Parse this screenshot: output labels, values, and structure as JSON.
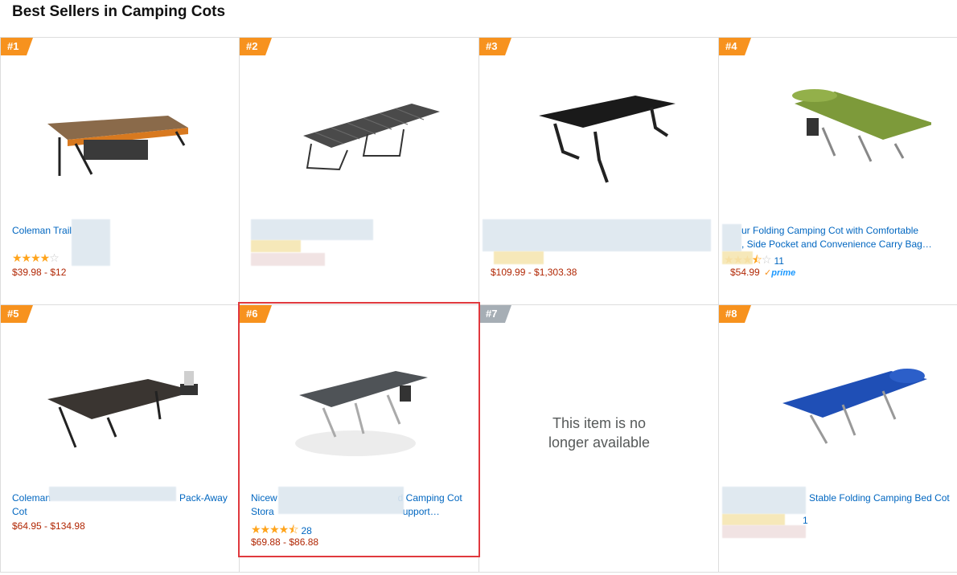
{
  "page": {
    "title": "Best Sellers in Camping Cots"
  },
  "items": [
    {
      "rank": "#1",
      "title": "Coleman Trail",
      "stars": 4,
      "price": "$39.98 - $12"
    },
    {
      "rank": "#2",
      "title": "",
      "stars": null,
      "price": ""
    },
    {
      "rank": "#3",
      "title": "",
      "stars": null,
      "price": "$109.99 - $1,303.38"
    },
    {
      "rank": "#4",
      "title_line1": "ur Folding Camping Cot with Comfortable",
      "title_line2": ", Side Pocket and Convenience Carry Bag…",
      "stars": 3.5,
      "reviews": "11",
      "price": "$54.99",
      "prime": "prime"
    },
    {
      "rank": "#5",
      "title_line1": "Coleman",
      "title_line1_end": "Pack-Away",
      "title_line2": "Cot",
      "price": "$64.95 - $134.98"
    },
    {
      "rank": "#6",
      "title_line1": "Nicew",
      "title_line1_end": "d Camping Cot",
      "title_line2": "Stora",
      "title_line2_end": "upport…",
      "stars": 4.5,
      "reviews": "28",
      "price": "$69.88 - $86.88"
    },
    {
      "rank": "#7",
      "unavailable": "This item is no longer available"
    },
    {
      "rank": "#8",
      "title_end": "Stable Folding Camping Bed Cot",
      "reviews": "1"
    }
  ],
  "colors": {
    "badge": "#f7921e",
    "badge_unavailable": "#a6aeb5",
    "link": "#0066c0",
    "price": "#b12704",
    "star": "#ffa41c",
    "highlight": "#e0393e"
  },
  "icons": {
    "star": "star-icon",
    "prime": "prime-logo"
  }
}
